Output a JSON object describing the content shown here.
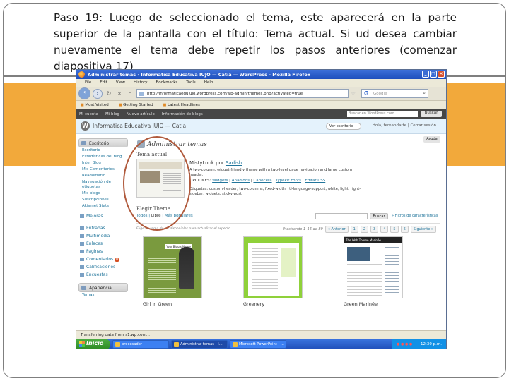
{
  "caption": "Paso 19: Luego de seleccionado el tema, este aparecerá en la parte superior de la pantalla con el título: Tema actual. Si ud desea cambiar nuevamente el tema debe repetir los pasos anteriores (comenzar diapositiva 17)",
  "browser": {
    "window_title": "Administrar temas ‹ Informatica Educativa IUJO — Catia — WordPress - Mozilla Firefox",
    "menu": [
      "File",
      "Edit",
      "View",
      "History",
      "Bookmarks",
      "Tools",
      "Help"
    ],
    "url": "http://informaticaeduiujo.wordpress.com/wp-admin/themes.php?activated=true",
    "search_placeholder": "Google",
    "bookmarks": [
      "Most Visited",
      "Getting Started",
      "Latest Headlines"
    ],
    "window_buttons": {
      "minimize": "_",
      "maximize": "□",
      "close": "×"
    }
  },
  "wp_admin_bar": {
    "items": [
      "Mi cuenta",
      "Mi blog",
      "Nuevo artículo",
      "Información de blogs"
    ],
    "search_placeholder": "Buscar en WordPress.com",
    "search_button": "Buscar"
  },
  "wp_header": {
    "logo": "W",
    "site_title": "Informatica Educativa IUJO — Catia",
    "visit_site": "Ver escritorio",
    "howdy": "Hola, fernandarte | Cerrar sesión"
  },
  "sidebar": {
    "escritorio": "Escritorio",
    "sub_items": [
      "Escritorio",
      "Estadísticas del blog",
      "Inter Blog",
      "Mis Comentarios",
      "Readomatic",
      "Navegación de etiquetas",
      "Mis blogs",
      "Suscripciones",
      "Akismet Stats"
    ],
    "mejoras": "Mejoras",
    "entradas": "Entradas",
    "multimedia": "Multimedia",
    "enlaces": "Enlaces",
    "paginas": "Páginas",
    "comentarios": "Comentarios",
    "comentarios_badge": "0",
    "calificaciones": "Calificaciones",
    "encuestas": "Encuestas",
    "apariencia": "Apariencia",
    "temas": "Temas"
  },
  "main": {
    "help_button": "Ayuda",
    "page_title": "Administrar temas",
    "current_theme_label": "Tema actual",
    "current_theme_name": "MistyLook por ",
    "current_theme_author": "Sadish",
    "current_theme_desc": "A two-column, widget-friendly theme with a two-level page navigation and large custom header.",
    "operations_label": "OPCIONES: ",
    "operations": [
      "Widgets",
      "Añadidos",
      "Cabecera",
      "Typekit Fonts",
      "Editar CSS"
    ],
    "tags": "Etiquetas: custom-header, two-columns, fixed-width, rtl-language-support, white, light, right-sidebar, widgets, sticky-post",
    "browse_title": "Elegir Theme",
    "browse_tabs": [
      "Todos",
      "Libre",
      "Más populares"
    ],
    "browse_active": "Libre",
    "search_button": "Buscar",
    "advanced_link": "» Filtros de características",
    "hint": "Elige un tema de los disponibles para actualizar el aspecto",
    "pager_info": "Mostrando 1–15 de 89",
    "pager": [
      "« Anterior",
      "1",
      "2",
      "3",
      "4",
      "5",
      "6",
      "Siguiente »"
    ],
    "themes": [
      "Girl in Green",
      "Greenery",
      "Green Marinée"
    ],
    "theme1_blogname": "Your Blog's Name",
    "theme3_header": "The Web Theme Marinée"
  },
  "statusbar": "Transferring data from s1.wp.com...",
  "taskbar": {
    "start": "Inicio",
    "tasks": [
      "procesador",
      "Administrar temas - I...",
      "Microsoft PowerPoint - ..."
    ],
    "clock": "12:30 p.m."
  },
  "colors": {
    "accent_orange": "#f2a93b",
    "wp_link": "#21759b",
    "annotation_circle": "#b05a3c",
    "xp_taskbar": "#245edb"
  }
}
